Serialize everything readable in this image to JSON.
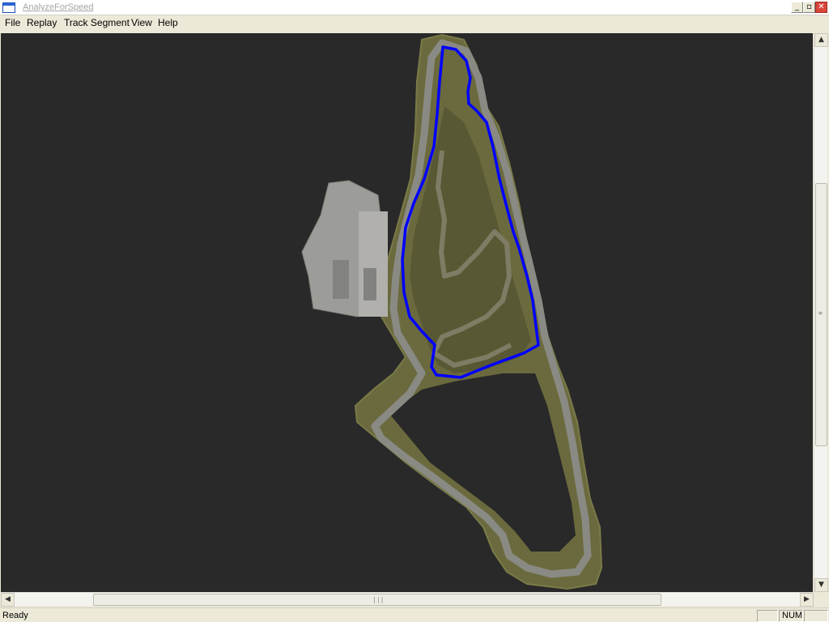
{
  "window": {
    "title": "AnalyzeForSpeed",
    "buttons": {
      "minimize": "_",
      "maximize": "▫",
      "close": "✕"
    }
  },
  "menu": {
    "items": [
      {
        "label": "File"
      },
      {
        "label": "Replay"
      },
      {
        "label": "Track Segment"
      },
      {
        "label": "View"
      },
      {
        "label": "Help"
      }
    ]
  },
  "canvas": {
    "background": "#292929",
    "terrain_color": "#6b6a3e",
    "track_color": "#8a8a84",
    "building_color": "#9c9c98",
    "selected_segment_color": "#0000ff",
    "selected_segment": "highlighted loop"
  },
  "scrollbars": {
    "vertical": {
      "up": "▲",
      "down": "▼",
      "grip": "≡"
    },
    "horizontal": {
      "left": "◀",
      "right": "▶",
      "grip": "|||"
    }
  },
  "status": {
    "text": "Ready",
    "num_indicator": "NUM"
  }
}
